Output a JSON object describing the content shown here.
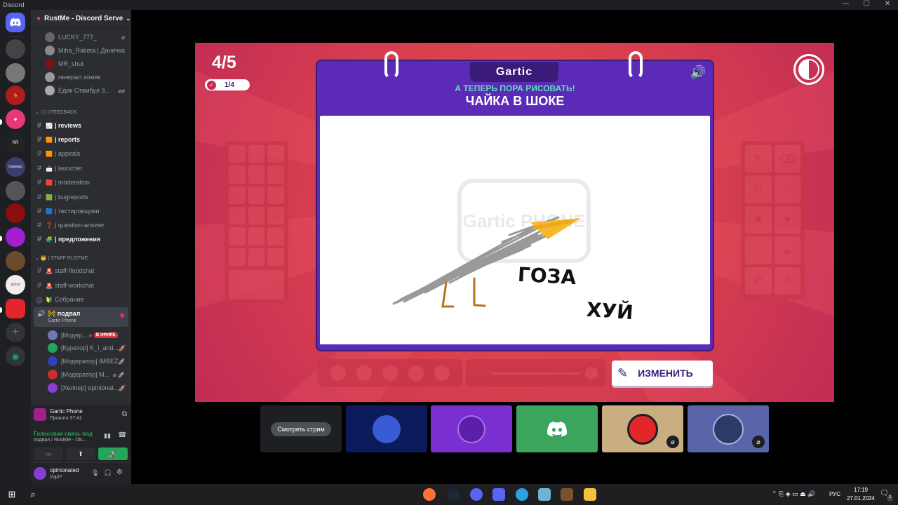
{
  "window": {
    "title": "Discord"
  },
  "server": {
    "name": "RustMe - Discord Serve",
    "voice_users_top": [
      {
        "name": "LUCKY_777_"
      },
      {
        "name": "Miha_Raketa | Данечка"
      },
      {
        "name": "MR_shut"
      },
      {
        "name": "генерал хомяк"
      },
      {
        "name": "Едик Стамбул 3..."
      }
    ],
    "category_feedback": "| FEEDBACK",
    "feedback_channels": [
      {
        "emoji": "📈",
        "name": "| reviews",
        "bright": true
      },
      {
        "emoji": "🟧",
        "name": "| reports",
        "bright": true
      },
      {
        "emoji": "🟧",
        "name": "| appeals",
        "bright": false
      },
      {
        "emoji": "📩",
        "name": "| launcher",
        "bright": false
      },
      {
        "emoji": "🟥",
        "name": "| moderation",
        "bright": false
      },
      {
        "emoji": "🟩",
        "name": "| bugreports",
        "bright": false
      },
      {
        "emoji": "🟦",
        "name": "| тестировщики",
        "bright": false
      },
      {
        "emoji": "❓",
        "name": "| question-answer",
        "bright": false
      },
      {
        "emoji": "🧩",
        "name": "| предложения",
        "bright": true
      }
    ],
    "category_staff": "| STAFF RUSTME",
    "staff_channels": [
      {
        "emoji": "🚨",
        "name": "staff-floodchat"
      },
      {
        "emoji": "🚨",
        "name": "staff-workchat"
      },
      {
        "emoji": "🔰",
        "name": "Собрание"
      }
    ],
    "active_voice": {
      "name": "подвал",
      "activity": "Gartic Phone"
    },
    "voice_members": [
      {
        "name": "[Модер...",
        "live": "В ЭФИРЕ"
      },
      {
        "name": "[Куратор] K_I_and..."
      },
      {
        "name": "[Модератор] IMBEZ"
      },
      {
        "name": "[Модератор] M..."
      },
      {
        "name": "[Хелпер] opinionat..."
      }
    ]
  },
  "activity_panel": {
    "title": "Gartic Phone",
    "elapsed": "Прошло 37:41"
  },
  "voice_panel": {
    "status": "Голосовая связь под",
    "location": "подвал / RustMe - Dis..."
  },
  "user_panel": {
    "name": "opinionated",
    "status": "//opi?"
  },
  "game": {
    "round": "4/5",
    "done_count": "1/4",
    "logo": "Gartic",
    "prompt_label": "А ТЕПЕРЬ ПОРА РИСОВАТЬ!",
    "prompt_word": "ЧАЙКА В ШОКЕ",
    "watermark": "Gartic PHONE",
    "drawn_text_1": "ГОЗА",
    "drawn_text_2": "ХУЙ",
    "edit_button": "ИЗМЕНИТЬ"
  },
  "stream_tiles": [
    {
      "label": "Смотреть стрим",
      "bg": "#1e1f22"
    },
    {
      "label": "",
      "bg": "#0b1b5c"
    },
    {
      "label": "",
      "bg": "#7a2fd1"
    },
    {
      "label": "",
      "bg": "#3ba55d"
    },
    {
      "label": "",
      "bg": "#c9ae82"
    },
    {
      "label": "",
      "bg": "#5865a8"
    }
  ],
  "taskbar": {
    "lang": "РУС",
    "time": "17:19",
    "date": "27.01.2024",
    "notif": "2"
  },
  "colors": {
    "blurple": "#5865f2",
    "green": "#23a55a",
    "game_purple": "#5b2bb8",
    "pen_yellow": "#f5b92e"
  }
}
